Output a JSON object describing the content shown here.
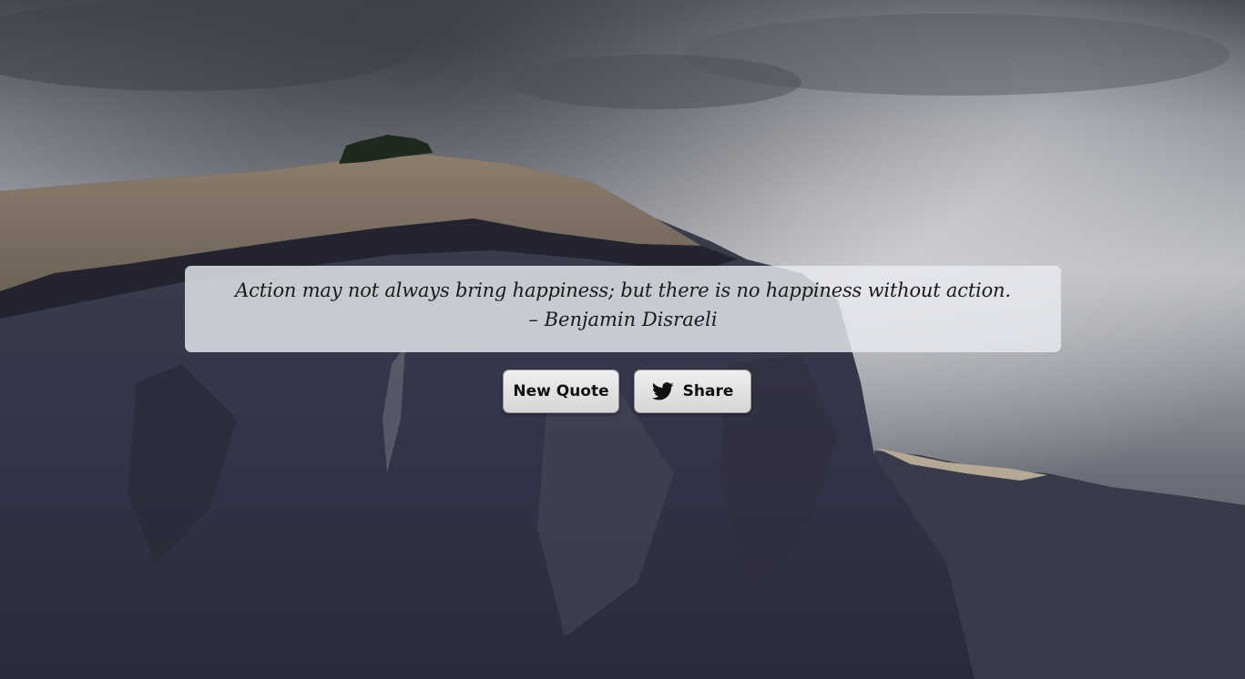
{
  "quote": {
    "text": "Action may not always bring happiness; but there is no happiness without action.",
    "author": "– Benjamin Disraeli"
  },
  "buttons": {
    "new_quote_label": "New Quote",
    "share_label": "Share",
    "share_icon": "twitter-icon"
  },
  "colors": {
    "quote_panel": "#e8eaf0",
    "button_face": "#e4e4e4",
    "text": "#1a1a1a"
  }
}
